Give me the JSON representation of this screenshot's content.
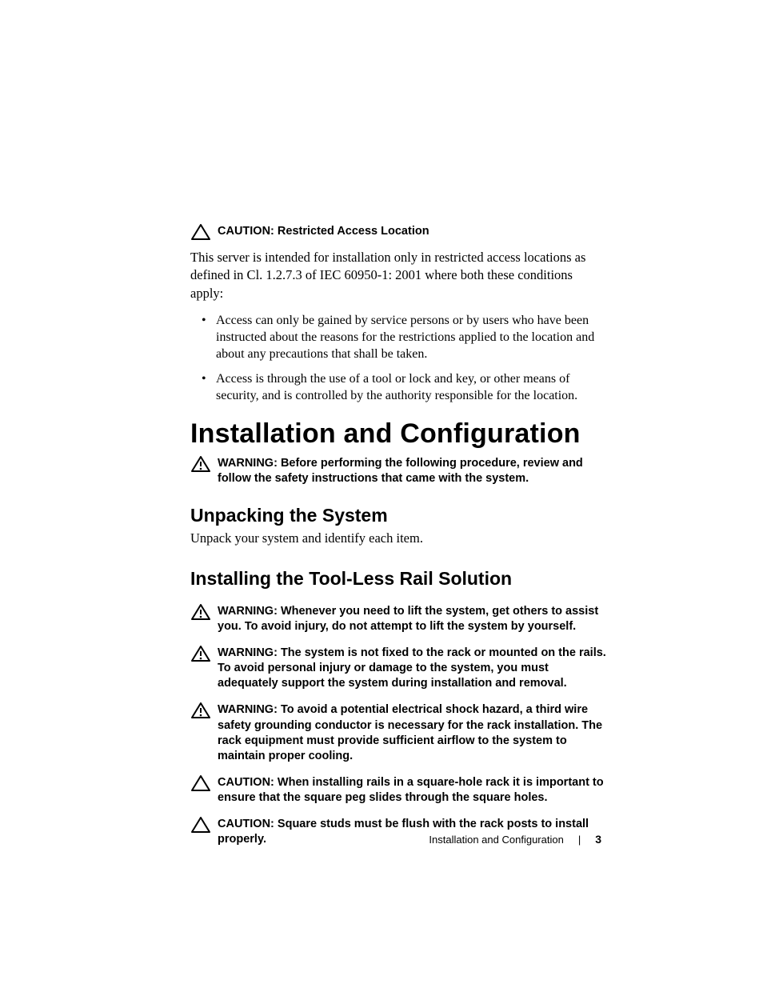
{
  "caution1": {
    "label": "CAUTION:",
    "body": "Restricted Access Location"
  },
  "intro_para": "This server is intended for installation only in restricted access locations as defined in Cl. 1.2.7.3 of IEC 60950-1: 2001 where both these conditions apply:",
  "bullets": [
    "Access can only be gained by service persons or by users who have been instructed about the reasons for the restrictions applied to the location and about any precautions that shall be taken.",
    "Access is through the use of a tool or lock and key, or other means of security, and is controlled by the authority responsible for the location."
  ],
  "h1": "Installation and Configuration",
  "warning1": {
    "label": "WARNING: ",
    "body": "Before performing the following procedure, review and follow the safety instructions that came with the system."
  },
  "h2_unpack": "Unpacking the System",
  "unpack_para": "Unpack your system and identify each item.",
  "h2_rail": "Installing the Tool-Less Rail Solution",
  "warning2": {
    "label": "WARNING: ",
    "body": "Whenever you need to lift the system, get others to assist you. To avoid injury, do not attempt to lift the system by yourself."
  },
  "warning3": {
    "label": "WARNING: ",
    "body": "The system is not fixed to the rack or mounted on the rails. To avoid personal injury or damage to the system, you must adequately support the system during installation and removal."
  },
  "warning4": {
    "label": "WARNING: ",
    "body": "To avoid a potential electrical shock hazard, a third wire safety grounding conductor is necessary for the rack installation. The rack equipment must provide sufficient airflow to the system to maintain proper cooling."
  },
  "caution2": {
    "label": "CAUTION:",
    "body": "When installing rails in a square-hole rack it is important to ensure that the square peg slides through the square holes."
  },
  "caution3": {
    "label": "CAUTION:",
    "body": "Square studs must be flush with the rack posts to install properly."
  },
  "footer": {
    "section": "Installation and Configuration",
    "page": "3"
  }
}
